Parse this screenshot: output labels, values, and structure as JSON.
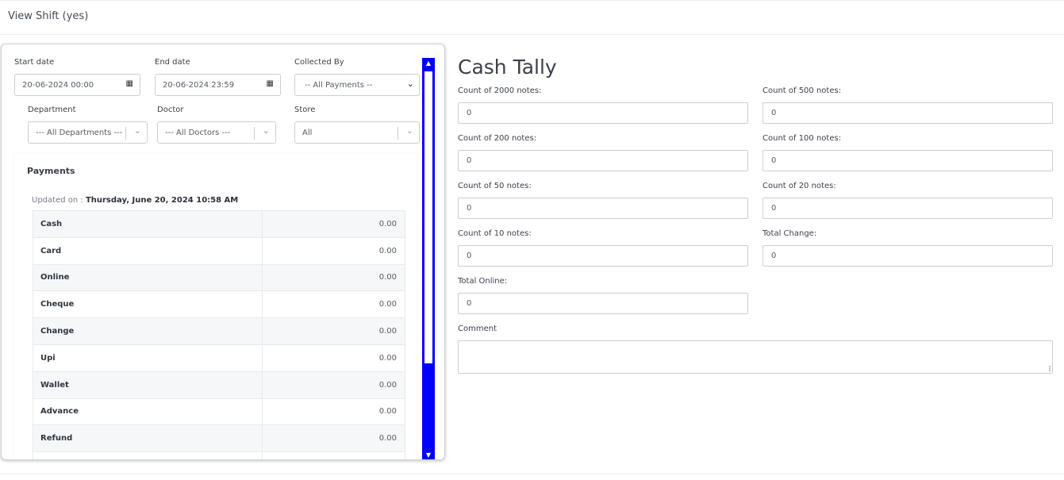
{
  "header": {
    "title": "View Shift (yes)"
  },
  "filters": {
    "start_date": {
      "label": "Start date",
      "value": "20-06-2024 00:00"
    },
    "end_date": {
      "label": "End date",
      "value": "20-06-2024 23:59"
    },
    "collected_by": {
      "label": "Collected By",
      "value": "-- All Payments --"
    },
    "department": {
      "label": "Department",
      "value": "--- All Departments ---"
    },
    "doctor": {
      "label": "Doctor",
      "value": "--- All Doctors ---"
    },
    "store": {
      "label": "Store",
      "value": "All"
    }
  },
  "payments": {
    "title": "Payments",
    "updated_prefix": "Updated on :",
    "updated_value": "Thursday, June 20, 2024 10:58 AM",
    "rows": [
      {
        "name": "Cash",
        "value": "0.00"
      },
      {
        "name": "Card",
        "value": "0.00"
      },
      {
        "name": "Online",
        "value": "0.00"
      },
      {
        "name": "Cheque",
        "value": "0.00"
      },
      {
        "name": "Change",
        "value": "0.00"
      },
      {
        "name": "Upi",
        "value": "0.00"
      },
      {
        "name": "Wallet",
        "value": "0.00"
      },
      {
        "name": "Advance",
        "value": "0.00"
      },
      {
        "name": "Refund",
        "value": "0.00"
      },
      {
        "name": "",
        "value": ""
      }
    ]
  },
  "cash_tally": {
    "title": "Cash Tally",
    "fields": {
      "n2000": {
        "label": "Count of 2000 notes:",
        "value": "0"
      },
      "n500": {
        "label": "Count of 500 notes:",
        "value": "0"
      },
      "n200": {
        "label": "Count of 200 notes:",
        "value": "0"
      },
      "n100": {
        "label": "Count of 100 notes:",
        "value": "0"
      },
      "n50": {
        "label": "Count of 50 notes:",
        "value": "0"
      },
      "n20": {
        "label": "Count of 20 notes:",
        "value": "0"
      },
      "n10": {
        "label": "Count of 10 notes:",
        "value": "0"
      },
      "total_change": {
        "label": "Total Change:",
        "value": "0"
      },
      "total_online": {
        "label": "Total Online:",
        "value": "0"
      }
    },
    "comment_label": "Comment"
  },
  "colors": {
    "scrollbar": "#0000ff",
    "border": "#c9ced5"
  },
  "icons": {
    "calendar": "calendar-icon",
    "chevron": "chevron-down-icon"
  }
}
